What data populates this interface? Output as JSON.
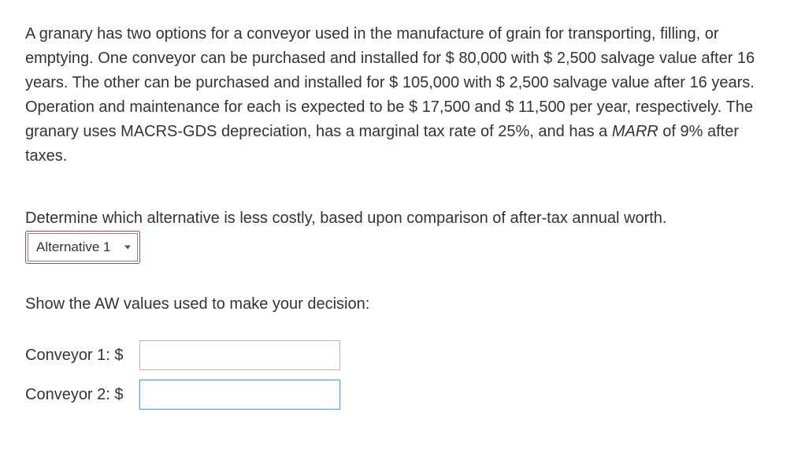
{
  "problem": {
    "text_parts": [
      "A granary has two options for a conveyor used in the manufacture of grain for transporting, filling, or emptying. One conveyor can be purchased and installed for $ 80,000 with $ 2,500 salvage value after 16 years. The other can be purchased and installed for $ 105,000 with $ 2,500 salvage value after 16 years. Operation and maintenance for each is expected to be $ 17,500 and $ 11,500 per year, respectively. The granary uses MACRS-GDS depreciation, has a marginal tax rate of 25%, and has a ",
      "MARR",
      " of 9% after taxes."
    ]
  },
  "question": {
    "prompt": "Determine which alternative is less costly, based upon comparison of after-tax annual worth.",
    "selected_option": "Alternative 1"
  },
  "instruction": "Show the AW values used to make your decision:",
  "answers": {
    "conveyor1": {
      "label": "Conveyor 1: $",
      "value": ""
    },
    "conveyor2": {
      "label": "Conveyor 2: $",
      "value": ""
    }
  }
}
